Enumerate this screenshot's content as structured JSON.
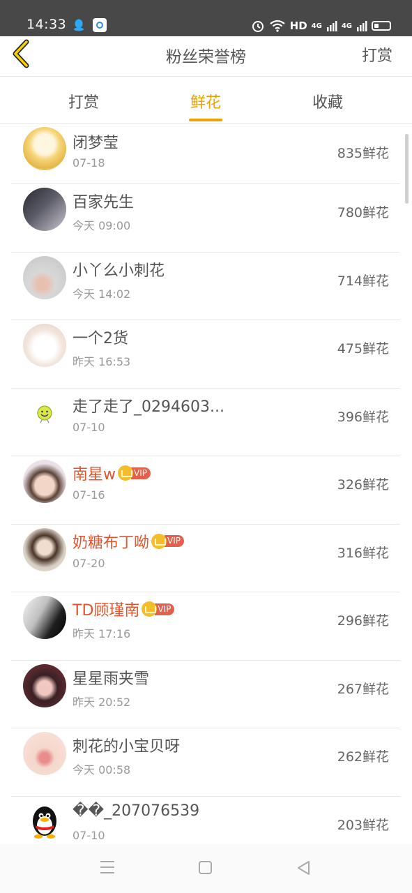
{
  "status_bar": {
    "time": "14:33",
    "hd": "HD",
    "net1": "4G",
    "net2": "4G"
  },
  "header": {
    "title": "粉丝荣誉榜",
    "action": "打赏"
  },
  "tabs": [
    {
      "label": "打赏",
      "active": false
    },
    {
      "label": "鲜花",
      "active": true
    },
    {
      "label": "收藏",
      "active": false
    }
  ],
  "accent_color": "#f0a000",
  "vip_name_color": "#e2542c",
  "list": [
    {
      "name": "闭梦莹",
      "date": "07-18",
      "count": "835鲜花",
      "vip": false
    },
    {
      "name": "百家先生",
      "date": "今天 09:00",
      "count": "780鲜花",
      "vip": false
    },
    {
      "name": "小丫么小刺花",
      "date": "今天 14:02",
      "count": "714鲜花",
      "vip": false
    },
    {
      "name": "一个2货",
      "date": "昨天 16:53",
      "count": "475鲜花",
      "vip": false
    },
    {
      "name": "走了走了_0294603...",
      "date": "07-10",
      "count": "396鲜花",
      "vip": false
    },
    {
      "name": "南星w",
      "date": "07-16",
      "count": "326鲜花",
      "vip": true,
      "badge": "VIP"
    },
    {
      "name": "奶糖布丁呦",
      "date": "07-20",
      "count": "316鲜花",
      "vip": true,
      "badge": "VIP"
    },
    {
      "name": "TD顾瑾南",
      "date": "昨天 17:16",
      "count": "296鲜花",
      "vip": true,
      "badge": "VIP"
    },
    {
      "name": "星星雨夹雪",
      "date": "昨天 20:52",
      "count": "267鲜花",
      "vip": false
    },
    {
      "name": "刺花的小宝贝呀",
      "date": "今天 00:58",
      "count": "262鲜花",
      "vip": false
    },
    {
      "name": "��_207076539",
      "date": "07-10",
      "count": "203鲜花",
      "vip": false
    }
  ]
}
